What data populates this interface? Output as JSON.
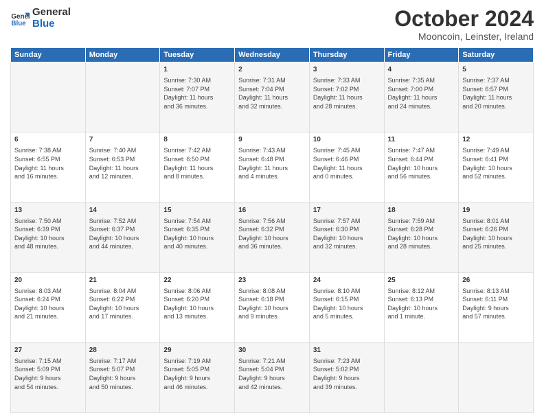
{
  "logo": {
    "line1": "General",
    "line2": "Blue"
  },
  "title": "October 2024",
  "subtitle": "Mooncoin, Leinster, Ireland",
  "headers": [
    "Sunday",
    "Monday",
    "Tuesday",
    "Wednesday",
    "Thursday",
    "Friday",
    "Saturday"
  ],
  "weeks": [
    [
      {
        "day": "",
        "info": ""
      },
      {
        "day": "",
        "info": ""
      },
      {
        "day": "1",
        "info": "Sunrise: 7:30 AM\nSunset: 7:07 PM\nDaylight: 11 hours\nand 36 minutes."
      },
      {
        "day": "2",
        "info": "Sunrise: 7:31 AM\nSunset: 7:04 PM\nDaylight: 11 hours\nand 32 minutes."
      },
      {
        "day": "3",
        "info": "Sunrise: 7:33 AM\nSunset: 7:02 PM\nDaylight: 11 hours\nand 28 minutes."
      },
      {
        "day": "4",
        "info": "Sunrise: 7:35 AM\nSunset: 7:00 PM\nDaylight: 11 hours\nand 24 minutes."
      },
      {
        "day": "5",
        "info": "Sunrise: 7:37 AM\nSunset: 6:57 PM\nDaylight: 11 hours\nand 20 minutes."
      }
    ],
    [
      {
        "day": "6",
        "info": "Sunrise: 7:38 AM\nSunset: 6:55 PM\nDaylight: 11 hours\nand 16 minutes."
      },
      {
        "day": "7",
        "info": "Sunrise: 7:40 AM\nSunset: 6:53 PM\nDaylight: 11 hours\nand 12 minutes."
      },
      {
        "day": "8",
        "info": "Sunrise: 7:42 AM\nSunset: 6:50 PM\nDaylight: 11 hours\nand 8 minutes."
      },
      {
        "day": "9",
        "info": "Sunrise: 7:43 AM\nSunset: 6:48 PM\nDaylight: 11 hours\nand 4 minutes."
      },
      {
        "day": "10",
        "info": "Sunrise: 7:45 AM\nSunset: 6:46 PM\nDaylight: 11 hours\nand 0 minutes."
      },
      {
        "day": "11",
        "info": "Sunrise: 7:47 AM\nSunset: 6:44 PM\nDaylight: 10 hours\nand 56 minutes."
      },
      {
        "day": "12",
        "info": "Sunrise: 7:49 AM\nSunset: 6:41 PM\nDaylight: 10 hours\nand 52 minutes."
      }
    ],
    [
      {
        "day": "13",
        "info": "Sunrise: 7:50 AM\nSunset: 6:39 PM\nDaylight: 10 hours\nand 48 minutes."
      },
      {
        "day": "14",
        "info": "Sunrise: 7:52 AM\nSunset: 6:37 PM\nDaylight: 10 hours\nand 44 minutes."
      },
      {
        "day": "15",
        "info": "Sunrise: 7:54 AM\nSunset: 6:35 PM\nDaylight: 10 hours\nand 40 minutes."
      },
      {
        "day": "16",
        "info": "Sunrise: 7:56 AM\nSunset: 6:32 PM\nDaylight: 10 hours\nand 36 minutes."
      },
      {
        "day": "17",
        "info": "Sunrise: 7:57 AM\nSunset: 6:30 PM\nDaylight: 10 hours\nand 32 minutes."
      },
      {
        "day": "18",
        "info": "Sunrise: 7:59 AM\nSunset: 6:28 PM\nDaylight: 10 hours\nand 28 minutes."
      },
      {
        "day": "19",
        "info": "Sunrise: 8:01 AM\nSunset: 6:26 PM\nDaylight: 10 hours\nand 25 minutes."
      }
    ],
    [
      {
        "day": "20",
        "info": "Sunrise: 8:03 AM\nSunset: 6:24 PM\nDaylight: 10 hours\nand 21 minutes."
      },
      {
        "day": "21",
        "info": "Sunrise: 8:04 AM\nSunset: 6:22 PM\nDaylight: 10 hours\nand 17 minutes."
      },
      {
        "day": "22",
        "info": "Sunrise: 8:06 AM\nSunset: 6:20 PM\nDaylight: 10 hours\nand 13 minutes."
      },
      {
        "day": "23",
        "info": "Sunrise: 8:08 AM\nSunset: 6:18 PM\nDaylight: 10 hours\nand 9 minutes."
      },
      {
        "day": "24",
        "info": "Sunrise: 8:10 AM\nSunset: 6:15 PM\nDaylight: 10 hours\nand 5 minutes."
      },
      {
        "day": "25",
        "info": "Sunrise: 8:12 AM\nSunset: 6:13 PM\nDaylight: 10 hours\nand 1 minute."
      },
      {
        "day": "26",
        "info": "Sunrise: 8:13 AM\nSunset: 6:11 PM\nDaylight: 9 hours\nand 57 minutes."
      }
    ],
    [
      {
        "day": "27",
        "info": "Sunrise: 7:15 AM\nSunset: 5:09 PM\nDaylight: 9 hours\nand 54 minutes."
      },
      {
        "day": "28",
        "info": "Sunrise: 7:17 AM\nSunset: 5:07 PM\nDaylight: 9 hours\nand 50 minutes."
      },
      {
        "day": "29",
        "info": "Sunrise: 7:19 AM\nSunset: 5:05 PM\nDaylight: 9 hours\nand 46 minutes."
      },
      {
        "day": "30",
        "info": "Sunrise: 7:21 AM\nSunset: 5:04 PM\nDaylight: 9 hours\nand 42 minutes."
      },
      {
        "day": "31",
        "info": "Sunrise: 7:23 AM\nSunset: 5:02 PM\nDaylight: 9 hours\nand 39 minutes."
      },
      {
        "day": "",
        "info": ""
      },
      {
        "day": "",
        "info": ""
      }
    ]
  ]
}
